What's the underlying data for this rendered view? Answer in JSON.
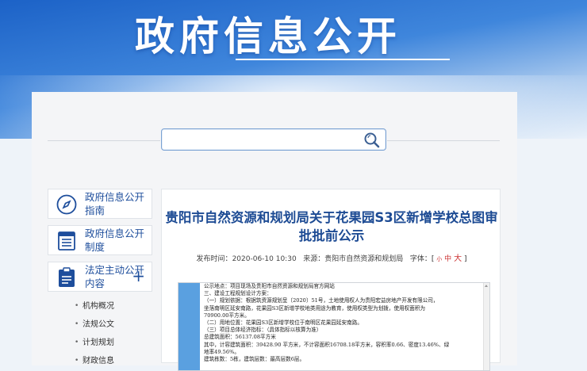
{
  "banner": {
    "title": "政府信息公开"
  },
  "search": {
    "placeholder": ""
  },
  "sidebar": {
    "items": [
      {
        "label": "政府信息公开指南",
        "icon": "compass-icon"
      },
      {
        "label": "政府信息公开制度",
        "icon": "document-list-icon"
      },
      {
        "label": "法定主动公开内容",
        "icon": "clipboard-icon",
        "expand": "+"
      }
    ],
    "sub_items": [
      "机构概况",
      "法规公文",
      "计划规划",
      "财政信息"
    ]
  },
  "article": {
    "title": "贵阳市自然资源和规划局关于花果园S3区新增学校总图审批批前公示",
    "publish_label": "发布时间：",
    "publish_time": "2020-06-10 10:30",
    "source_label": "来源：",
    "source": "贵阳市自然资源和规划局",
    "fontsize_label": "字体：",
    "fs_open": "[",
    "fs_small": "小",
    "fs_medium": "中",
    "fs_large": "大",
    "fs_close": "]"
  },
  "document": {
    "lines": [
      "公示地点：项目现场及贵阳市自然资源和规划局官方网站",
      "三、建设工程规划设计方案：",
      "（一）规划依据：根据筑资源规划呈〔2020〕51号，土地使用权人为贵阳宏益房地产开发有限公司，",
      "坐落南明区延安南路，花果园S3区新增学校地类用途为教育，使用权类型为划拨，使用权面积为",
      "70900.00平方米。",
      "（二）用地位置：花果园S3区新增学校位于南明区花果园延安南路。",
      "（三）项目总体经济指标：（具体指标以核算为准）",
      "总建筑面积：56137.08平方米",
      "其中，计容建筑面积：39428.90 平方米，不计容面积16708.18平方米，容积率0.66、密度13.46%、绿",
      "地率49.56%。",
      "建筑栋数：5栋，建筑层数：最高层数6层。"
    ]
  },
  "colors": {
    "accent": "#1d4b94",
    "banner": "#2f78d4"
  }
}
